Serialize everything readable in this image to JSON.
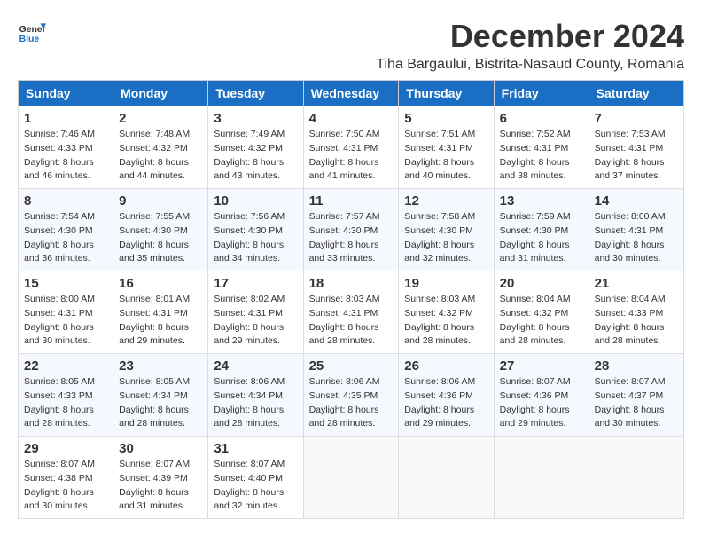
{
  "logo": {
    "line1": "General",
    "line2": "Blue"
  },
  "title": "December 2024",
  "location": "Tiha Bargaului, Bistrita-Nasaud County, Romania",
  "days_of_week": [
    "Sunday",
    "Monday",
    "Tuesday",
    "Wednesday",
    "Thursday",
    "Friday",
    "Saturday"
  ],
  "weeks": [
    [
      {
        "day": "1",
        "sunrise": "7:46 AM",
        "sunset": "4:33 PM",
        "daylight": "8 hours and 46 minutes."
      },
      {
        "day": "2",
        "sunrise": "7:48 AM",
        "sunset": "4:32 PM",
        "daylight": "8 hours and 44 minutes."
      },
      {
        "day": "3",
        "sunrise": "7:49 AM",
        "sunset": "4:32 PM",
        "daylight": "8 hours and 43 minutes."
      },
      {
        "day": "4",
        "sunrise": "7:50 AM",
        "sunset": "4:31 PM",
        "daylight": "8 hours and 41 minutes."
      },
      {
        "day": "5",
        "sunrise": "7:51 AM",
        "sunset": "4:31 PM",
        "daylight": "8 hours and 40 minutes."
      },
      {
        "day": "6",
        "sunrise": "7:52 AM",
        "sunset": "4:31 PM",
        "daylight": "8 hours and 38 minutes."
      },
      {
        "day": "7",
        "sunrise": "7:53 AM",
        "sunset": "4:31 PM",
        "daylight": "8 hours and 37 minutes."
      }
    ],
    [
      {
        "day": "8",
        "sunrise": "7:54 AM",
        "sunset": "4:30 PM",
        "daylight": "8 hours and 36 minutes."
      },
      {
        "day": "9",
        "sunrise": "7:55 AM",
        "sunset": "4:30 PM",
        "daylight": "8 hours and 35 minutes."
      },
      {
        "day": "10",
        "sunrise": "7:56 AM",
        "sunset": "4:30 PM",
        "daylight": "8 hours and 34 minutes."
      },
      {
        "day": "11",
        "sunrise": "7:57 AM",
        "sunset": "4:30 PM",
        "daylight": "8 hours and 33 minutes."
      },
      {
        "day": "12",
        "sunrise": "7:58 AM",
        "sunset": "4:30 PM",
        "daylight": "8 hours and 32 minutes."
      },
      {
        "day": "13",
        "sunrise": "7:59 AM",
        "sunset": "4:30 PM",
        "daylight": "8 hours and 31 minutes."
      },
      {
        "day": "14",
        "sunrise": "8:00 AM",
        "sunset": "4:31 PM",
        "daylight": "8 hours and 30 minutes."
      }
    ],
    [
      {
        "day": "15",
        "sunrise": "8:00 AM",
        "sunset": "4:31 PM",
        "daylight": "8 hours and 30 minutes."
      },
      {
        "day": "16",
        "sunrise": "8:01 AM",
        "sunset": "4:31 PM",
        "daylight": "8 hours and 29 minutes."
      },
      {
        "day": "17",
        "sunrise": "8:02 AM",
        "sunset": "4:31 PM",
        "daylight": "8 hours and 29 minutes."
      },
      {
        "day": "18",
        "sunrise": "8:03 AM",
        "sunset": "4:31 PM",
        "daylight": "8 hours and 28 minutes."
      },
      {
        "day": "19",
        "sunrise": "8:03 AM",
        "sunset": "4:32 PM",
        "daylight": "8 hours and 28 minutes."
      },
      {
        "day": "20",
        "sunrise": "8:04 AM",
        "sunset": "4:32 PM",
        "daylight": "8 hours and 28 minutes."
      },
      {
        "day": "21",
        "sunrise": "8:04 AM",
        "sunset": "4:33 PM",
        "daylight": "8 hours and 28 minutes."
      }
    ],
    [
      {
        "day": "22",
        "sunrise": "8:05 AM",
        "sunset": "4:33 PM",
        "daylight": "8 hours and 28 minutes."
      },
      {
        "day": "23",
        "sunrise": "8:05 AM",
        "sunset": "4:34 PM",
        "daylight": "8 hours and 28 minutes."
      },
      {
        "day": "24",
        "sunrise": "8:06 AM",
        "sunset": "4:34 PM",
        "daylight": "8 hours and 28 minutes."
      },
      {
        "day": "25",
        "sunrise": "8:06 AM",
        "sunset": "4:35 PM",
        "daylight": "8 hours and 28 minutes."
      },
      {
        "day": "26",
        "sunrise": "8:06 AM",
        "sunset": "4:36 PM",
        "daylight": "8 hours and 29 minutes."
      },
      {
        "day": "27",
        "sunrise": "8:07 AM",
        "sunset": "4:36 PM",
        "daylight": "8 hours and 29 minutes."
      },
      {
        "day": "28",
        "sunrise": "8:07 AM",
        "sunset": "4:37 PM",
        "daylight": "8 hours and 30 minutes."
      }
    ],
    [
      {
        "day": "29",
        "sunrise": "8:07 AM",
        "sunset": "4:38 PM",
        "daylight": "8 hours and 30 minutes."
      },
      {
        "day": "30",
        "sunrise": "8:07 AM",
        "sunset": "4:39 PM",
        "daylight": "8 hours and 31 minutes."
      },
      {
        "day": "31",
        "sunrise": "8:07 AM",
        "sunset": "4:40 PM",
        "daylight": "8 hours and 32 minutes."
      },
      null,
      null,
      null,
      null
    ]
  ]
}
